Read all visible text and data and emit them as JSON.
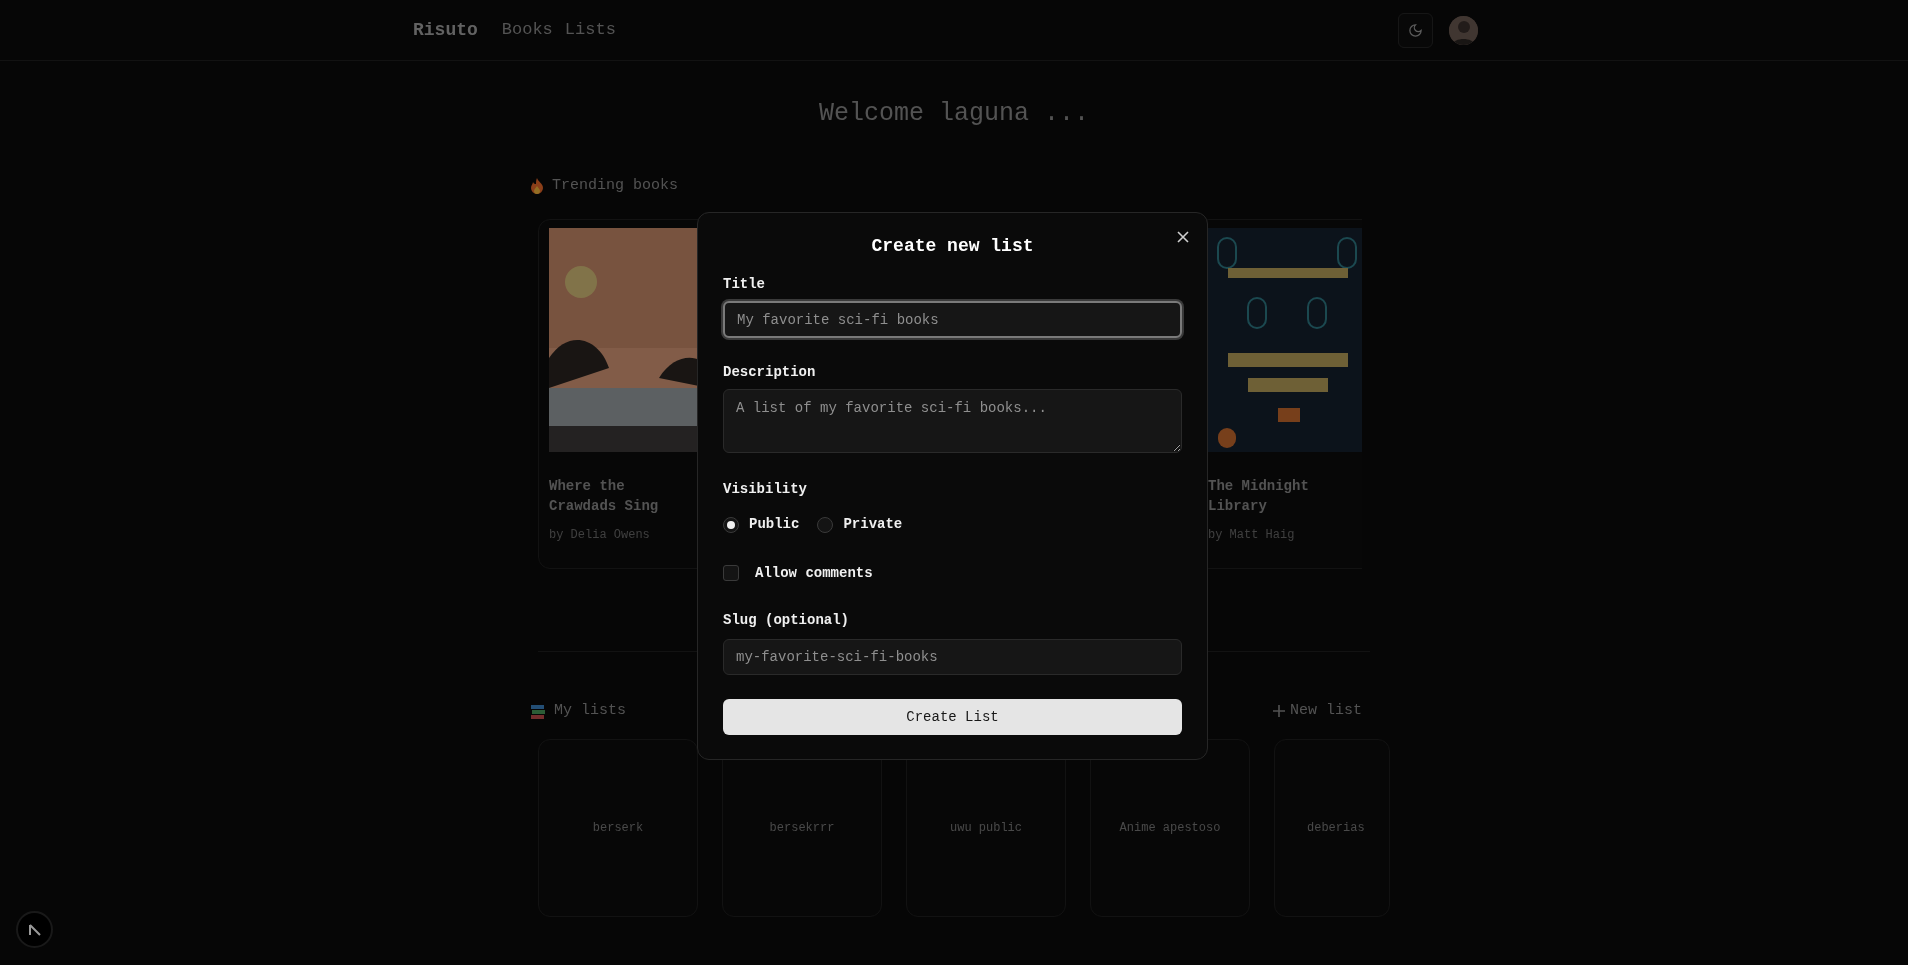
{
  "nav": {
    "logo": "Risuto",
    "links": [
      {
        "label": "Books"
      },
      {
        "label": "Lists"
      }
    ]
  },
  "welcome": "Welcome laguna ...",
  "trending": {
    "heading": "Trending books",
    "books": [
      {
        "title": "Where the Crawdads Sing",
        "author": "by Delia Owens"
      },
      {
        "title": "The Midnight Library",
        "author": "by Matt Haig"
      }
    ]
  },
  "my_lists": {
    "heading": "My lists",
    "new_list": "New list",
    "lists": [
      {
        "name": "berserk"
      },
      {
        "name": "bersekrrr"
      },
      {
        "name": "uwu public"
      },
      {
        "name": "Anime apestoso"
      },
      {
        "name": "deberias"
      }
    ]
  },
  "modal": {
    "title": "Create new list",
    "title_field": {
      "label": "Title",
      "placeholder": "My favorite sci-fi books",
      "focused": true
    },
    "description_field": {
      "label": "Description",
      "placeholder": "A list of my favorite sci-fi books..."
    },
    "visibility": {
      "label": "Visibility",
      "options": [
        {
          "label": "Public",
          "selected": true
        },
        {
          "label": "Private",
          "selected": false
        }
      ]
    },
    "allow_comments": {
      "label": "Allow comments",
      "checked": false
    },
    "slug_field": {
      "label": "Slug (optional)",
      "placeholder": "my-favorite-sci-fi-books"
    },
    "submit": "Create List"
  }
}
